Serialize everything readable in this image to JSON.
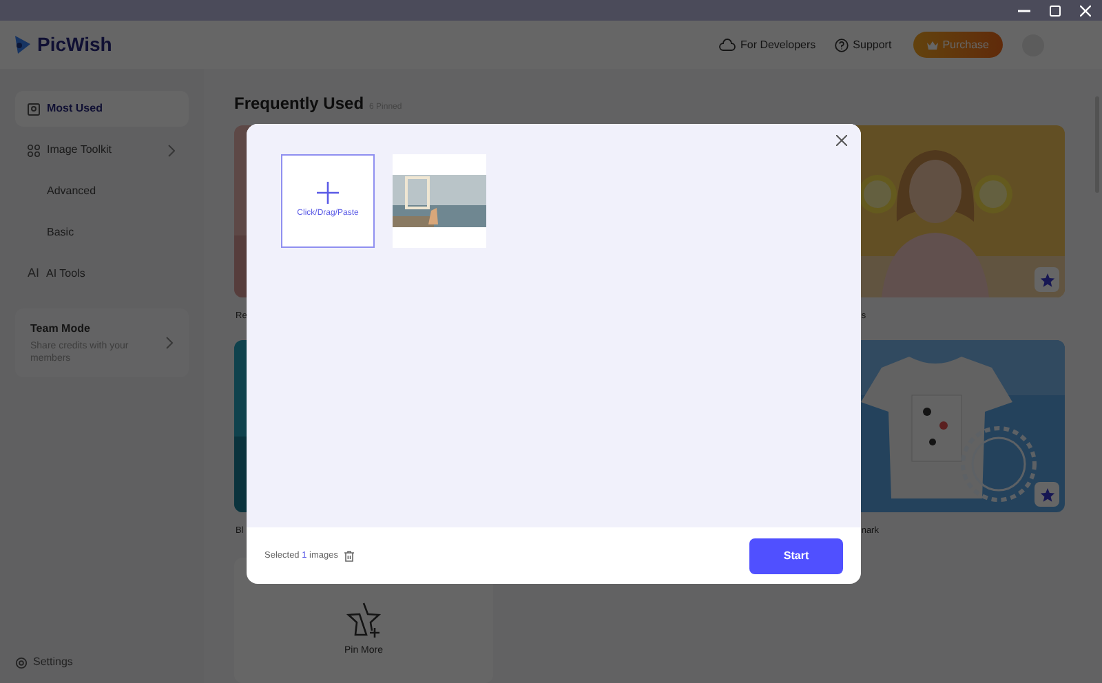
{
  "app": {
    "name": "PicWish"
  },
  "header": {
    "links": [
      {
        "label": "For Developers"
      },
      {
        "label": "Support"
      }
    ],
    "purchase": "Purchase"
  },
  "sidebar": {
    "items": [
      {
        "kind": "home",
        "label": "Most Used",
        "selected": true
      },
      {
        "kind": "toolkit",
        "label": "Image Toolkit",
        "selected": false
      },
      {
        "kind": "sub",
        "label": "Advanced",
        "selected": false
      },
      {
        "kind": "sub",
        "label": "Basic",
        "selected": false
      },
      {
        "kind": "ai",
        "glyph": "AI",
        "label": "AI Tools",
        "selected": false
      }
    ],
    "team": {
      "title": "Team Mode",
      "subtitle": "Share credits with your members"
    },
    "settings": "Settings"
  },
  "main": {
    "title": "Frequently Used",
    "badge": "6 Pinned",
    "cards": [
      {
        "kind": "portrait",
        "label": "Re"
      },
      {
        "kind": "lemons",
        "label": "s"
      },
      {
        "kind": "sea",
        "label": "Bl"
      },
      {
        "kind": "shirt",
        "label": "nark"
      }
    ],
    "pin_more": "Pin More"
  },
  "modal": {
    "upload": "Click/Drag/Paste",
    "selected_prefix": "Selected",
    "selected_count": "1",
    "selected_suffix": "images",
    "start": "Start"
  }
}
